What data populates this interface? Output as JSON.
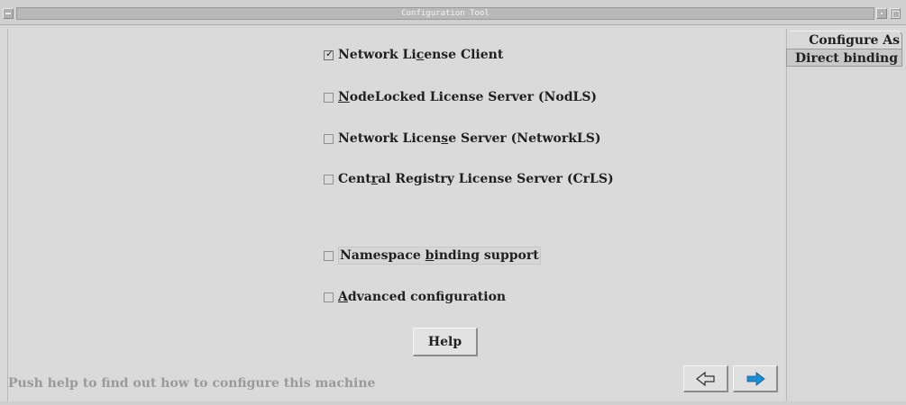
{
  "window": {
    "title": "Configuration Tool"
  },
  "options": [
    {
      "pre": "Network Li",
      "u": "c",
      "post": "ense Client",
      "checked": true
    },
    {
      "pre": "",
      "u": "N",
      "post": "odeLocked License Server (NodLS)",
      "checked": false
    },
    {
      "pre": "Network Licen",
      "u": "s",
      "post": "e Server (NetworkLS)",
      "checked": false
    },
    {
      "pre": "Cent",
      "u": "r",
      "post": "al Registry License Server (CrLS)",
      "checked": false
    },
    {
      "pre": "Namespace ",
      "u": "b",
      "post": "inding support",
      "checked": false
    },
    {
      "pre": "",
      "u": "A",
      "post": "dvanced configuration",
      "checked": false
    }
  ],
  "help_button": "Help",
  "status_text": "Push help to find out how to configure this machine",
  "tabs": [
    {
      "label": "Configure As",
      "selected": false
    },
    {
      "label": "Direct binding",
      "selected": true
    }
  ],
  "colors": {
    "accent_arrow": "#1a8fd6"
  },
  "icons": {
    "back": "left-arrow-outline-icon",
    "next": "right-arrow-filled-icon"
  }
}
